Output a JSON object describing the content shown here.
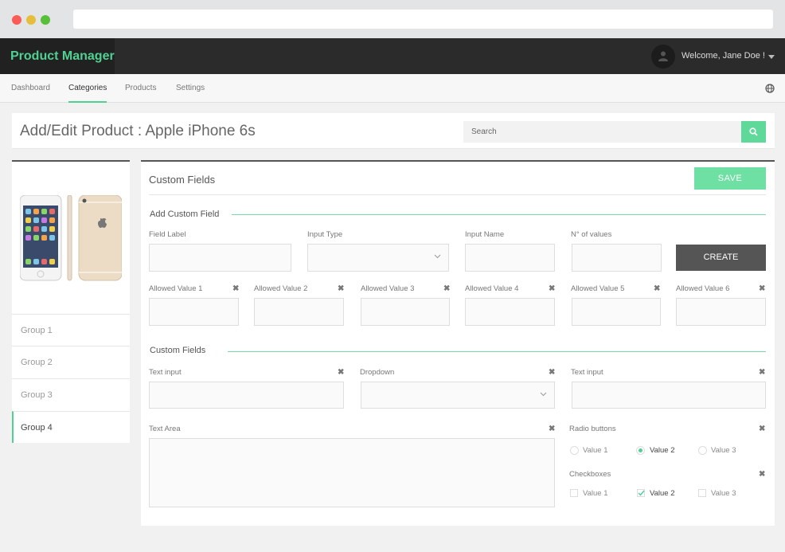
{
  "app": {
    "brand": "Product Manager",
    "welcome": "Welcome,  Jane Doe !"
  },
  "nav": {
    "items": [
      "Dashboard",
      "Categories",
      "Products",
      "Settings"
    ],
    "active": "Categories"
  },
  "header": {
    "title": "Add/Edit Product  :  Apple iPhone 6s",
    "search_placeholder": "Search"
  },
  "sidebar": {
    "groups": [
      "Group 1",
      "Group 2",
      "Group 3",
      "Group 4"
    ],
    "active_group": "Group 4"
  },
  "main": {
    "title": "Custom Fields",
    "save_label": "SAVE",
    "add_section": {
      "title": "Add Custom Field",
      "labels": {
        "field_label": "Field Label",
        "input_type": "Input Type",
        "input_name": "Input Name",
        "num_values": "N° of values"
      },
      "create_label": "CREATE",
      "allowed_values": [
        "Allowed Value 1",
        "Allowed Value 2",
        "Allowed Value 3",
        "Allowed Value 4",
        "Allowed Value 5",
        "Allowed Value 6"
      ]
    },
    "custom_section": {
      "title": "Custom Fields",
      "text_input_1": "Text input",
      "dropdown": "Dropdown",
      "text_input_2": "Text input",
      "text_area": "Text Area",
      "radio_title": "Radio buttons",
      "radio_options": [
        "Value 1",
        "Value 2",
        "Value 3"
      ],
      "radio_selected": "Value 2",
      "checkbox_title": "Checkboxes",
      "checkbox_options": [
        "Value 1",
        "Value 2",
        "Value 3"
      ],
      "checkbox_checked": [
        "Value 2"
      ]
    }
  },
  "colors": {
    "accent": "#4fd192",
    "appbar": "#2b2b2b",
    "create_button": "#555555"
  },
  "icons": [
    "user-icon",
    "caret-down-icon",
    "globe-icon",
    "search-icon",
    "chevron-down-icon",
    "close-icon",
    "check-icon"
  ]
}
